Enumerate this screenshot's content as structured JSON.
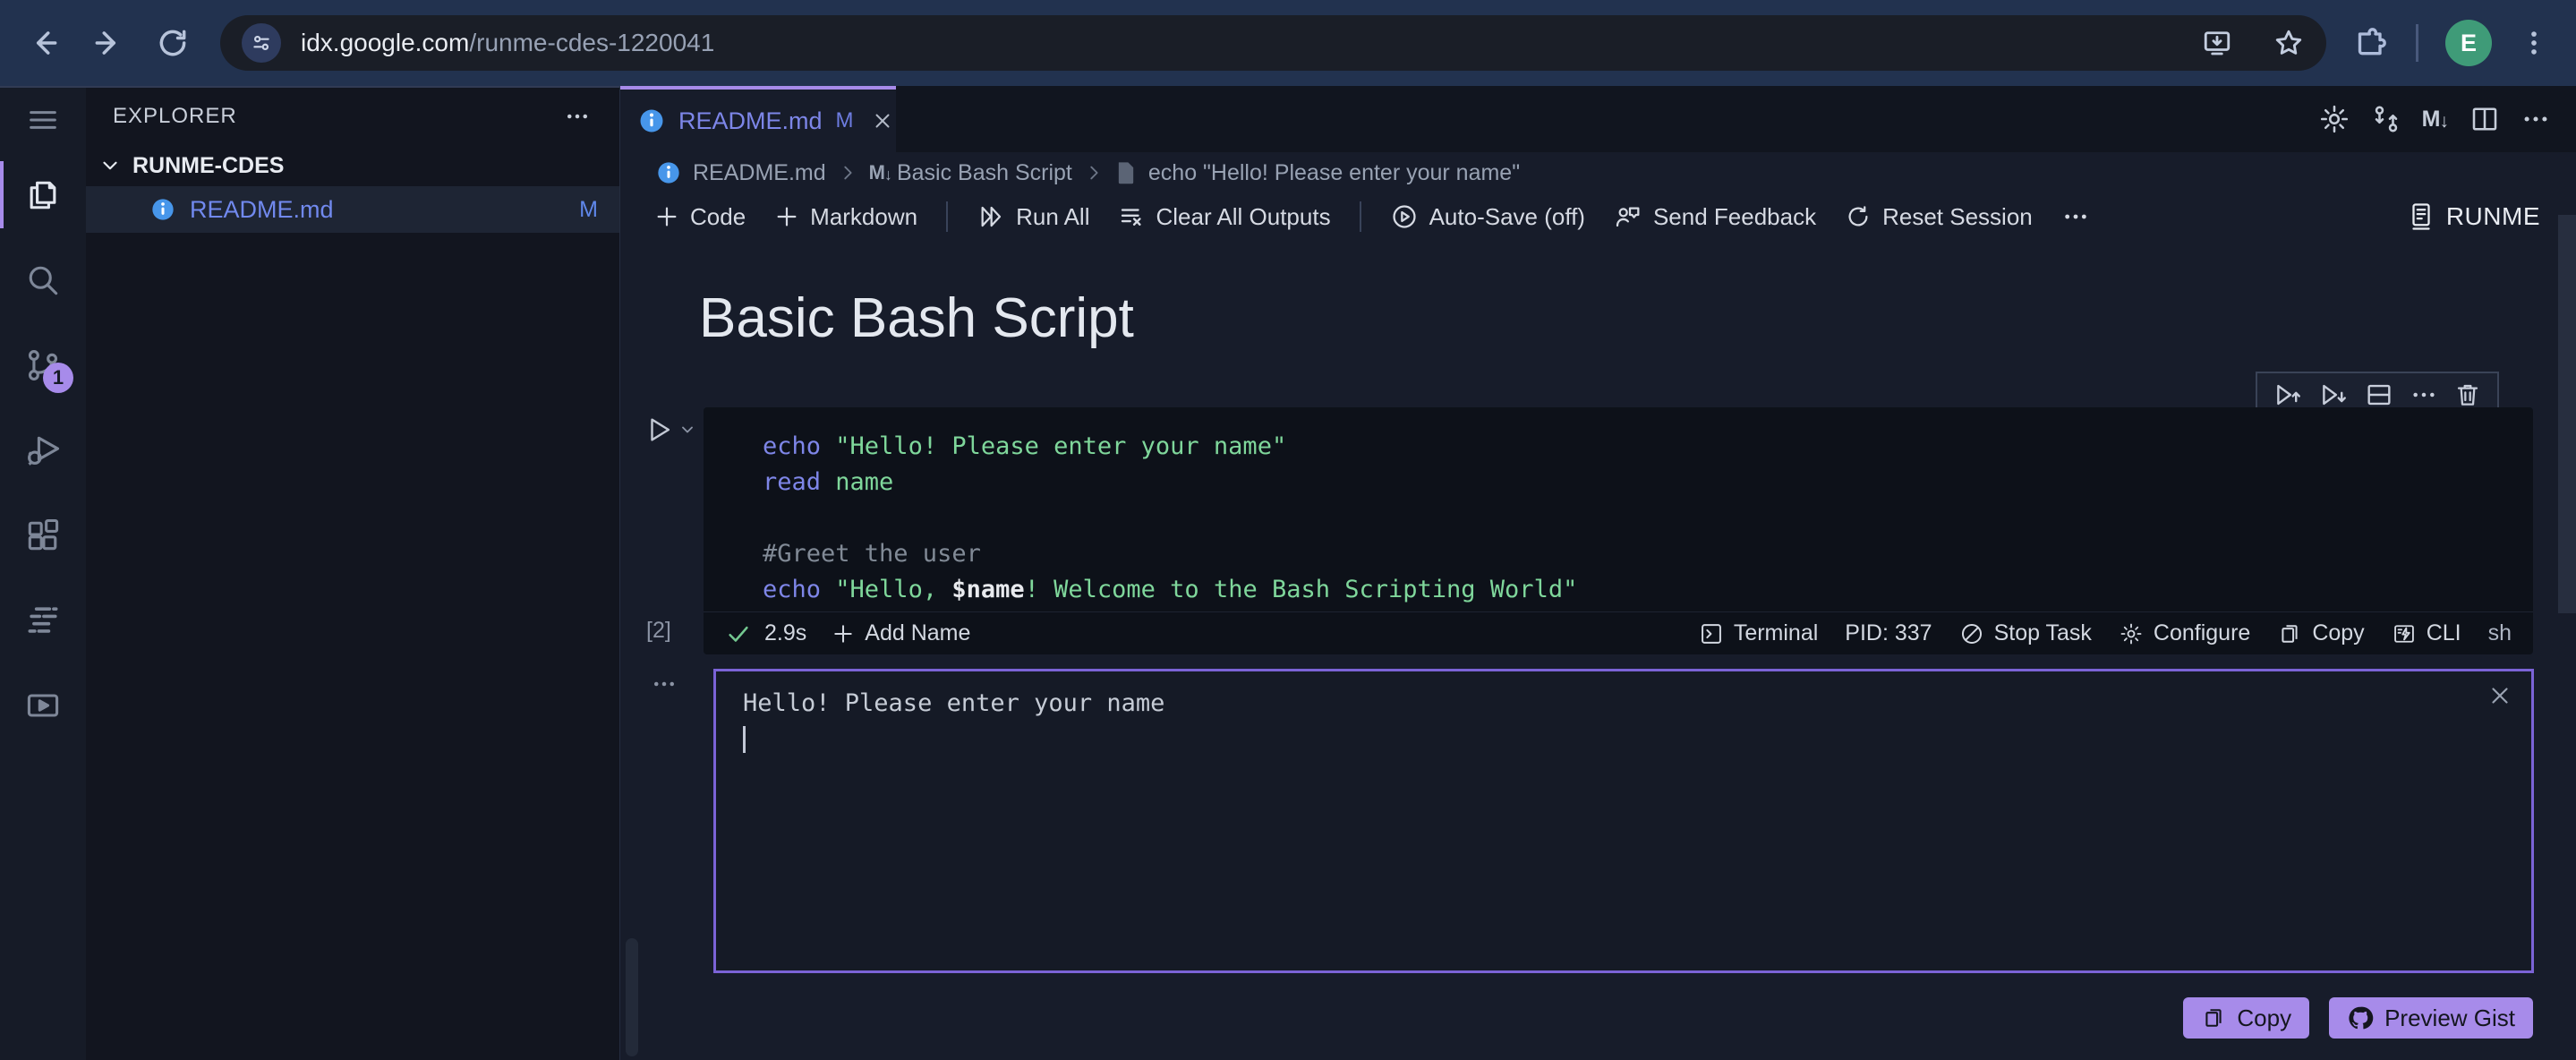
{
  "browser": {
    "url_host": "idx.google.com",
    "url_path": "/runme-cdes-1220041",
    "avatar_initial": "E"
  },
  "activity_bar": {
    "scm_badge": "1"
  },
  "sidebar": {
    "title": "EXPLORER",
    "folder": "RUNME-CDES",
    "file_name": "README.md",
    "file_badge": "M"
  },
  "tab": {
    "label": "README.md",
    "modified": "M"
  },
  "editor_actions": {
    "markdown_glyph": "M",
    "markdown_arrow": "↓"
  },
  "breadcrumb": {
    "file": "README.md",
    "markdown_glyph": "M",
    "markdown_arrow": "↓",
    "section": "Basic Bash Script",
    "leaf": "echo \"Hello! Please enter your name\""
  },
  "toolbar": {
    "code": "Code",
    "markdown": "Markdown",
    "run_all": "Run All",
    "clear_outputs": "Clear All Outputs",
    "auto_save": "Auto-Save (off)",
    "send_feedback": "Send Feedback",
    "reset_session": "Reset Session",
    "brand": "RUNME"
  },
  "notebook": {
    "title": "Basic Bash Script",
    "cell": {
      "execution_count": "[2]",
      "language": "sh",
      "code_lines": [
        {
          "tokens": [
            {
              "t": "kw",
              "v": "echo"
            },
            {
              "t": "str",
              "v": " \"Hello! Please enter your name\""
            }
          ]
        },
        {
          "tokens": [
            {
              "t": "kw",
              "v": "read"
            },
            {
              "t": "str",
              "v": " name"
            }
          ]
        },
        {
          "tokens": []
        },
        {
          "tokens": [
            {
              "t": "cm",
              "v": "#Greet the user"
            }
          ]
        },
        {
          "tokens": [
            {
              "t": "kw",
              "v": "echo"
            },
            {
              "t": "str",
              "v": " \"Hello, "
            },
            {
              "t": "var",
              "v": "$name"
            },
            {
              "t": "str",
              "v": "! Welcome to the Bash Scripting World\""
            }
          ]
        }
      ],
      "status": {
        "duration": "2.9s",
        "add_name": "Add Name",
        "terminal": "Terminal",
        "pid": "PID: 337",
        "stop": "Stop Task",
        "configure": "Configure",
        "copy": "Copy",
        "cli": "CLI"
      }
    },
    "output": {
      "text": "Hello! Please enter your name"
    },
    "gist_actions": {
      "copy": "Copy",
      "preview": "Preview Gist"
    }
  },
  "colors": {
    "accent_purple": "#a78bea",
    "info_blue": "#4796ea",
    "modified_blue": "#6d7ce0",
    "keyword": "#7e86e8",
    "string_green": "#7fd79b",
    "success_green": "#74c991",
    "avatar_green": "#3f9b78"
  }
}
